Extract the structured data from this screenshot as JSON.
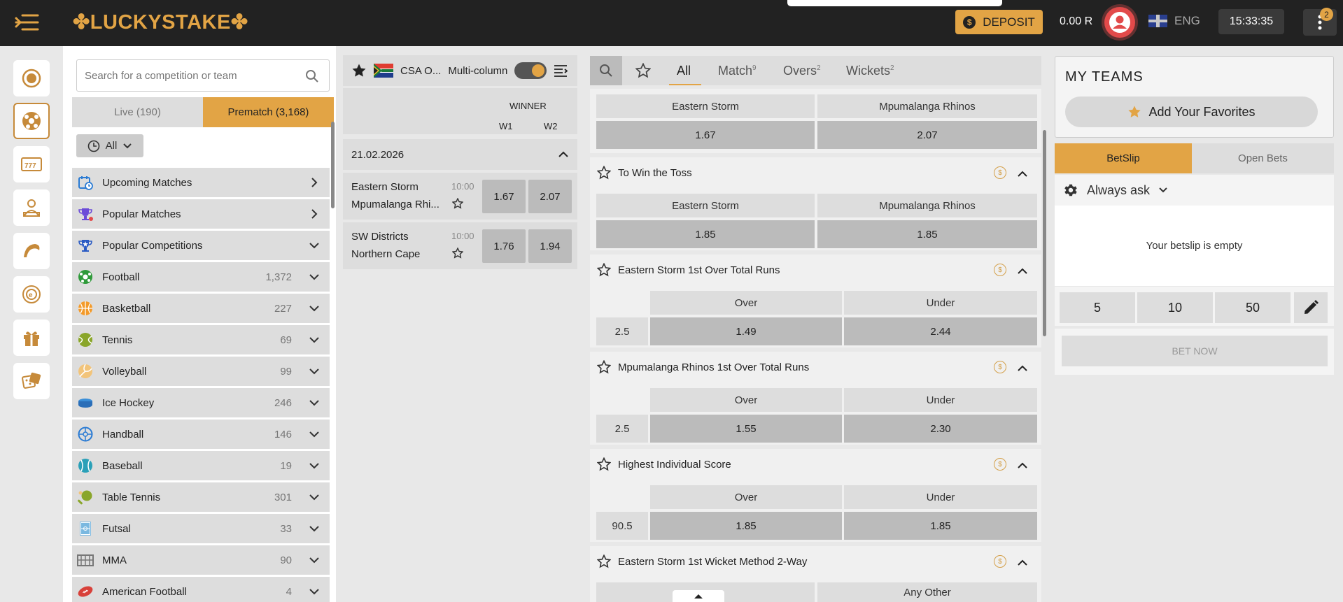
{
  "header": {
    "logo": "✤LUCKYSTAKE✤",
    "deposit_label": "DEPOSIT",
    "balance": "0.00 R",
    "language": "ENG",
    "clock": "15:33:35",
    "more_badge": "2"
  },
  "rail": {
    "items": [
      "live-icon",
      "sports-icon",
      "slots-icon",
      "live-casino-icon",
      "aviator-icon",
      "esports-icon",
      "gift-icon",
      "dice-icon"
    ]
  },
  "sports_panel": {
    "search_placeholder": "Search for a competition or team",
    "tab_live": "Live (190)",
    "tab_prematch": "Prematch (3,168)",
    "filter": "All",
    "items": [
      {
        "name": "Upcoming Matches",
        "count": ""
      },
      {
        "name": "Popular Matches",
        "count": ""
      },
      {
        "name": "Popular Competitions",
        "count": ""
      },
      {
        "name": "Football",
        "count": "1,372"
      },
      {
        "name": "Basketball",
        "count": "227"
      },
      {
        "name": "Tennis",
        "count": "69"
      },
      {
        "name": "Volleyball",
        "count": "99"
      },
      {
        "name": "Ice Hockey",
        "count": "246"
      },
      {
        "name": "Handball",
        "count": "146"
      },
      {
        "name": "Baseball",
        "count": "19"
      },
      {
        "name": "Table Tennis",
        "count": "301"
      },
      {
        "name": "Futsal",
        "count": "33"
      },
      {
        "name": "MMA",
        "count": "90"
      },
      {
        "name": "American Football",
        "count": "4"
      }
    ]
  },
  "match_col": {
    "title": "CSA O...",
    "multi_column_label": "Multi-column",
    "winner_label": "WINNER",
    "w1": "W1",
    "w2": "W2",
    "date": "21.02.2026",
    "matches": [
      {
        "team1": "Eastern Storm",
        "team2": "Mpumalanga Rhi...",
        "time": "10:00",
        "odd1": "1.67",
        "odd2": "2.07"
      },
      {
        "team1": "SW Districts",
        "team2": "Northern Cape",
        "time": "10:00",
        "odd1": "1.76",
        "odd2": "1.94"
      }
    ]
  },
  "markets": {
    "tabs": [
      {
        "label": "All",
        "count": ""
      },
      {
        "label": "Match",
        "count": "9"
      },
      {
        "label": "Overs",
        "count": "2"
      },
      {
        "label": "Wickets",
        "count": "2"
      }
    ],
    "winner_block": {
      "team1": "Eastern Storm",
      "team2": "Mpumalanga Rhinos",
      "odd1": "1.67",
      "odd2": "2.07"
    },
    "toss_block": {
      "title": "To Win the Toss",
      "team1": "Eastern Storm",
      "team2": "Mpumalanga Rhinos",
      "odd1": "1.85",
      "odd2": "1.85"
    },
    "ou_blocks": [
      {
        "title": "Eastern Storm 1st Over Total Runs",
        "over": "Over",
        "under": "Under",
        "line": "2.5",
        "odd_over": "1.49",
        "odd_under": "2.44"
      },
      {
        "title": "Mpumalanga Rhinos 1st Over Total Runs",
        "over": "Over",
        "under": "Under",
        "line": "2.5",
        "odd_over": "1.55",
        "odd_under": "2.30"
      },
      {
        "title": "Highest Individual Score",
        "over": "Over",
        "under": "Under",
        "line": "90.5",
        "odd_over": "1.85",
        "odd_under": "1.85"
      }
    ],
    "last_block": {
      "title": "Eastern Storm 1st Wicket Method 2-Way",
      "col2": "Any Other"
    }
  },
  "right": {
    "my_teams": "MY TEAMS",
    "add_favorites": "Add Your Favorites",
    "tab_betslip": "BetSlip",
    "tab_open_bets": "Open Bets",
    "always_ask": "Always ask",
    "empty": "Your betslip is empty",
    "stakes": [
      "5",
      "10",
      "50"
    ],
    "bet_now": "BET NOW"
  },
  "colors": {
    "accent": "#e2a445",
    "header_bg": "#222222",
    "panel_bg": "#dddddd",
    "odd_bg": "#bbbbbb"
  }
}
